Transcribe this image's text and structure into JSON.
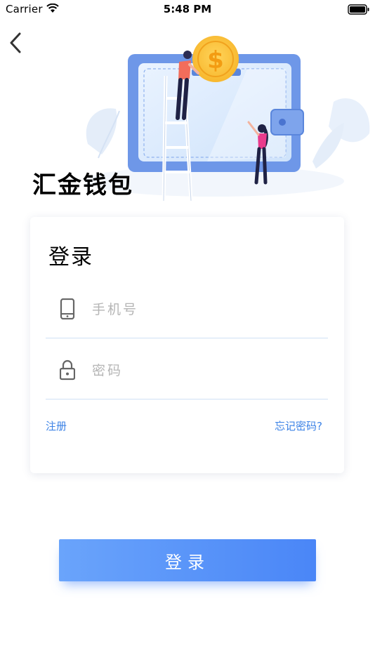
{
  "status_bar": {
    "carrier": "Carrier",
    "time": "5:48 PM"
  },
  "nav": {
    "back_icon": "chevron-left-icon"
  },
  "brand": {
    "title": "汇金钱包"
  },
  "login_card": {
    "title": "登录",
    "phone": {
      "icon": "phone-icon",
      "placeholder": "手机号",
      "value": ""
    },
    "password": {
      "icon": "lock-icon",
      "placeholder": "密码",
      "value": ""
    },
    "register_link": "注册",
    "forgot_link": "忘记密码?"
  },
  "login_button": {
    "label": "登录"
  },
  "colors": {
    "accent": "#4a86f7",
    "link": "#3b82e6",
    "divider": "#cfe0f5"
  }
}
